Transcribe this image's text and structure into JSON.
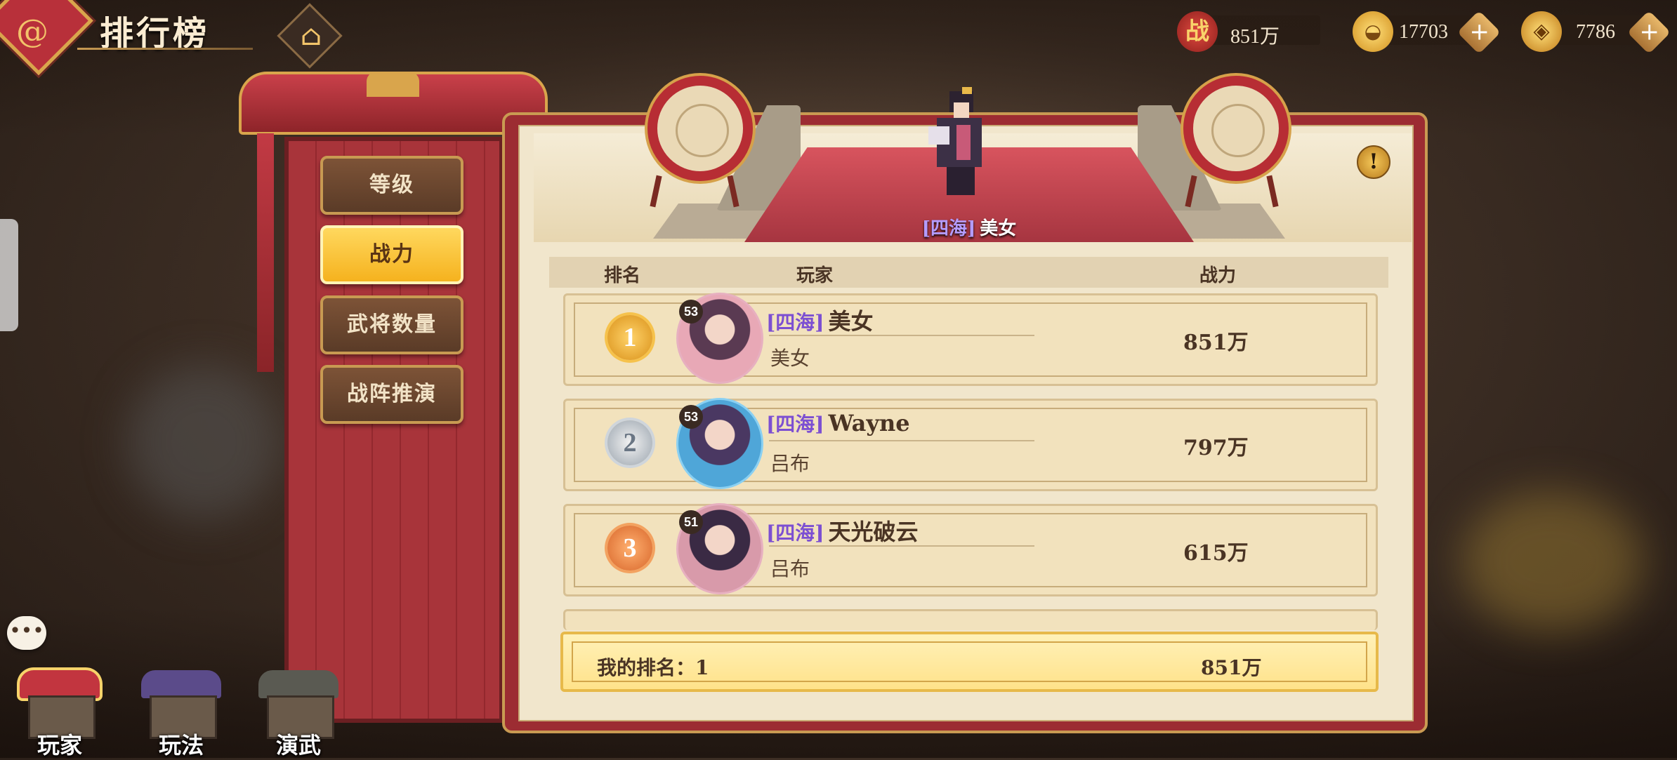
{
  "header": {
    "title": "排行榜"
  },
  "currency": {
    "power": {
      "icon_text": "战",
      "value": "851万"
    },
    "ingot": {
      "value": "17703"
    },
    "coin": {
      "value": "7786"
    }
  },
  "tabs": [
    {
      "label": "等级",
      "active": false
    },
    {
      "label": "战力",
      "active": true
    },
    {
      "label": "武将数量",
      "active": false
    },
    {
      "label": "战阵推演",
      "active": false
    }
  ],
  "champion": {
    "tag": "[四海]",
    "name": "美女"
  },
  "table": {
    "headers": {
      "rank": "排名",
      "player": "玩家",
      "power": "战力"
    },
    "rows": [
      {
        "rank": "1",
        "level": "53",
        "tag": "[四海]",
        "name": "美女",
        "hero": "美女",
        "power": "851万"
      },
      {
        "rank": "2",
        "level": "53",
        "tag": "[四海]",
        "name": "Wayne",
        "hero": "吕布",
        "power": "797万"
      },
      {
        "rank": "3",
        "level": "51",
        "tag": "[四海]",
        "name": "天光破云",
        "hero": "吕布",
        "power": "615万"
      }
    ]
  },
  "my_rank": {
    "label": "我的排名：1",
    "power": "851万"
  },
  "bottom_nav": [
    {
      "label": "玩家",
      "active": true,
      "roof_color": "#c2353f"
    },
    {
      "label": "玩法",
      "active": false,
      "roof_color": "#5b4b8a"
    },
    {
      "label": "演武",
      "active": false,
      "roof_color": "#5a5a52"
    }
  ],
  "icons": {
    "home": "home-icon",
    "info": "info-icon",
    "chat": "chat-icon",
    "logo": "swirl-logo-icon"
  }
}
